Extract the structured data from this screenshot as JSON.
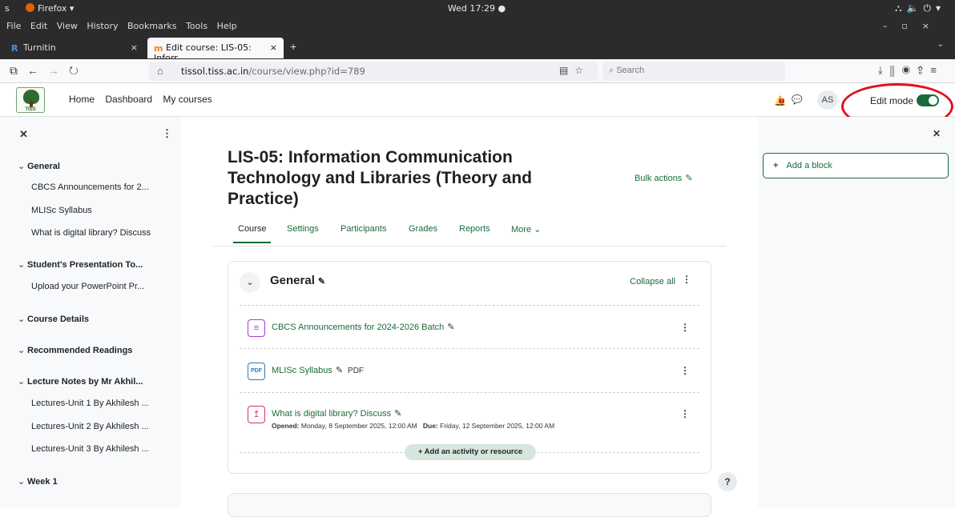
{
  "os": {
    "activities": "s",
    "app": "Firefox ▾",
    "clock": "Wed 17:29 ●"
  },
  "browser": {
    "menu": [
      "File",
      "Edit",
      "View",
      "History",
      "Bookmarks",
      "Tools",
      "Help"
    ],
    "tabs": [
      {
        "label": "Turnitin"
      },
      {
        "label": "Edit course: LIS-05: Inforr"
      }
    ],
    "url_domain": "tissol.tiss.ac.in",
    "url_path": "/course/view.php?id=789",
    "search_placeholder": "Search"
  },
  "header": {
    "logo_text": "TISS",
    "nav": [
      "Home",
      "Dashboard",
      "My courses"
    ],
    "notification_count": "7",
    "avatar": "AS",
    "edit_mode_label": "Edit mode",
    "edit_mode_on": true
  },
  "course_index": {
    "sections": [
      {
        "title": "General",
        "items": [
          "CBCS Announcements for 2...",
          "MLISc Syllabus",
          "What is digital library? Discuss"
        ]
      },
      {
        "title": "Student's Presentation To...",
        "items": [
          "Upload your PowerPoint Pr..."
        ]
      },
      {
        "title": "Course Details",
        "items": []
      },
      {
        "title": "Recommended Readings",
        "items": []
      },
      {
        "title": "Lecture Notes by Mr Akhil...",
        "items": [
          "Lectures-Unit 1 By Akhilesh ...",
          "Lectures-Unit 2 By Akhilesh ...",
          "Lectures-Unit 3 By Akhilesh ..."
        ]
      },
      {
        "title": "Week 1",
        "items": []
      }
    ]
  },
  "course": {
    "title": "LIS-05: Information Communication Technology and Libraries (Theory and Practice)",
    "bulk_actions": "Bulk actions",
    "tabs": [
      "Course",
      "Settings",
      "Participants",
      "Grades",
      "Reports",
      "More"
    ],
    "active_tab": "Course",
    "section": {
      "title": "General",
      "collapse_all": "Collapse all",
      "activities": [
        {
          "name": "CBCS Announcements for 2024-2026 Batch",
          "type": "",
          "icon": "forum-icon"
        },
        {
          "name": "MLISc Syllabus",
          "type": "PDF",
          "icon": "pdf-icon"
        },
        {
          "name": "What is digital library? Discuss",
          "type": "",
          "icon": "assignment-icon",
          "opened_label": "Opened:",
          "opened": "Monday, 8 September 2025, 12:00 AM",
          "due_label": "Due:",
          "due": "Friday, 12 September 2025, 12:00 AM"
        }
      ],
      "add_activity": "Add an activity or resource"
    }
  },
  "blocks": {
    "add_block": "Add a block"
  },
  "help": "?",
  "colors": {
    "brand_green": "#1a6b3a",
    "annotation_red": "#e0101a"
  }
}
